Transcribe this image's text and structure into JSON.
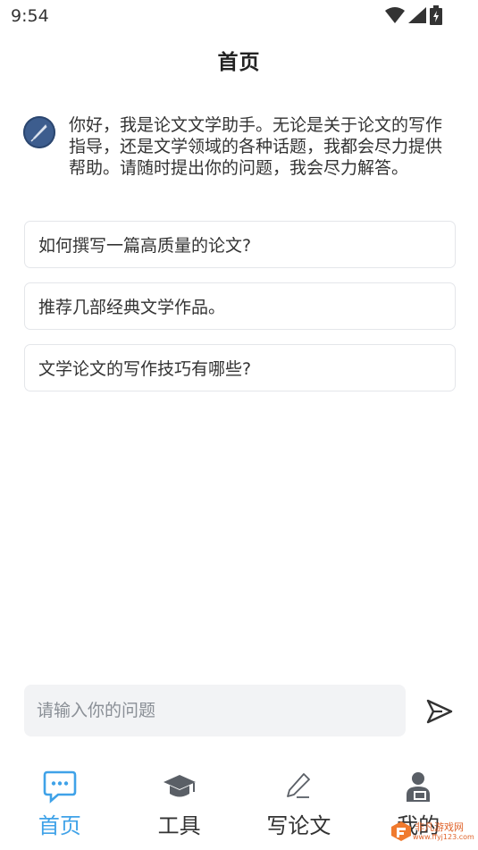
{
  "status_bar": {
    "time": "9:54"
  },
  "header": {
    "title": "首页"
  },
  "greeting": {
    "text": "你好，我是论文文学助手。无论是关于论文的写作指导，还是文学领域的各种话题，我都会尽力提供帮助。请随时提出你的问题，我会尽力解答。"
  },
  "suggestions": [
    {
      "label": "如何撰写一篇高质量的论文?"
    },
    {
      "label": "推荐几部经典文学作品。"
    },
    {
      "label": "文学论文的写作技巧有哪些?"
    }
  ],
  "input": {
    "placeholder": "请输入你的问题"
  },
  "nav": {
    "items": [
      {
        "label": "首页",
        "icon": "chat-bubble-icon",
        "active": true
      },
      {
        "label": "工具",
        "icon": "graduation-cap-icon",
        "active": false
      },
      {
        "label": "写论文",
        "icon": "pen-icon",
        "active": false
      },
      {
        "label": "我的",
        "icon": "user-icon",
        "active": false
      }
    ]
  },
  "watermark": {
    "text": "非凡游戏网",
    "sub": "www.ffyj123.com"
  },
  "colors": {
    "accent": "#3fa2e8",
    "input_bg": "#f2f3f5",
    "card_border": "#e4e6ea"
  }
}
